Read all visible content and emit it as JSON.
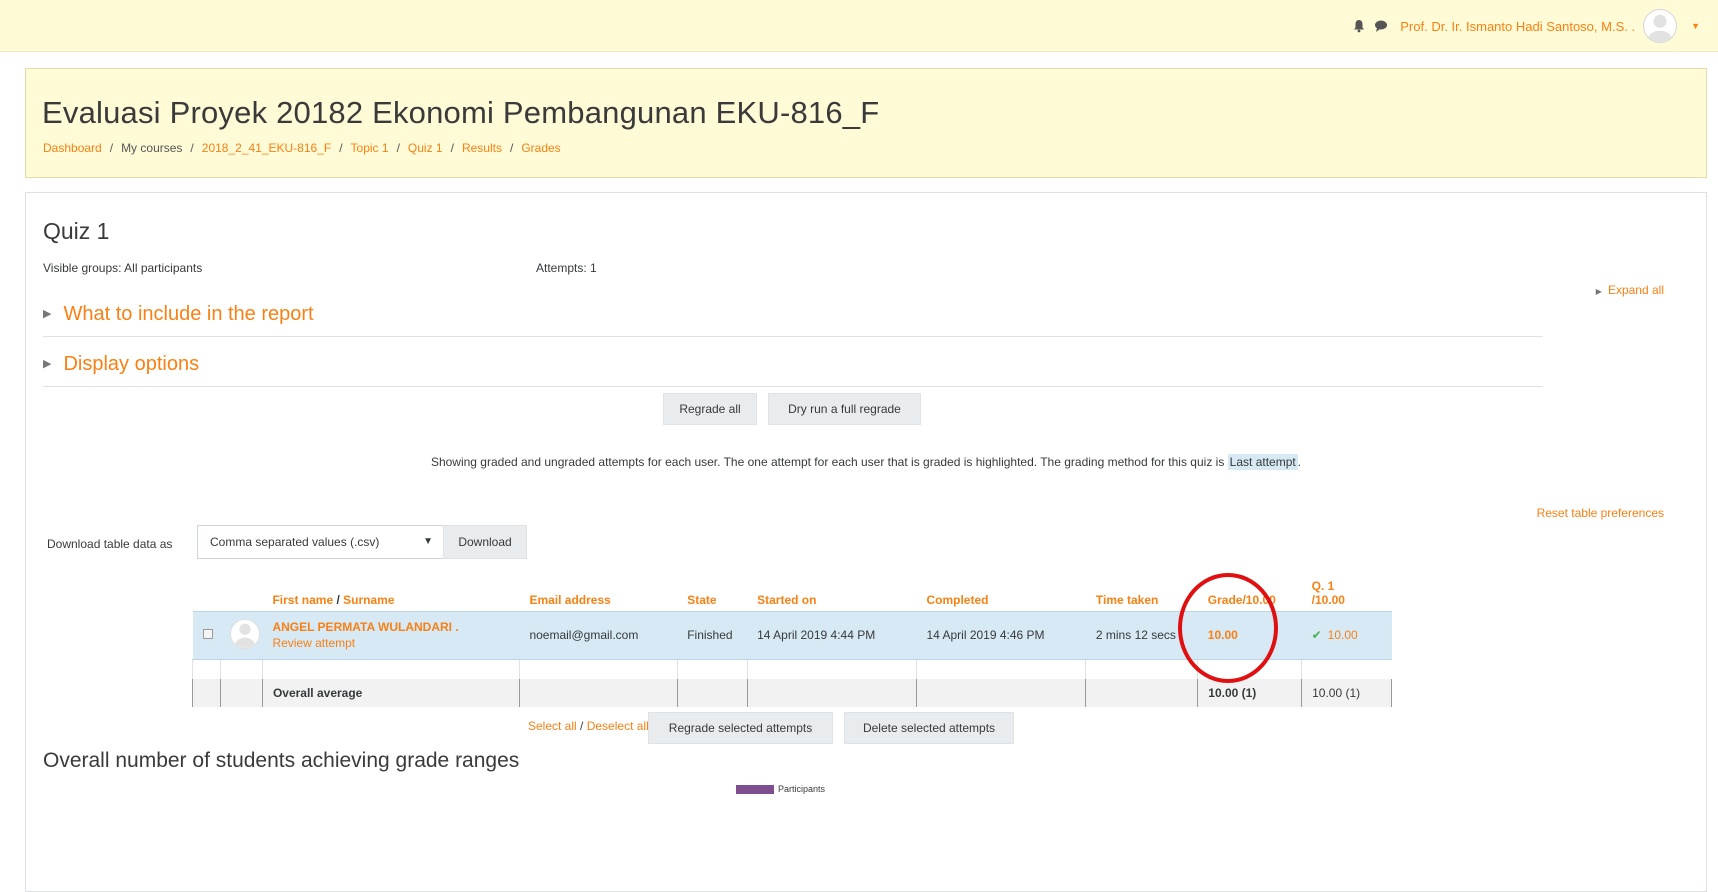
{
  "navbar": {
    "user_name": "Prof. Dr. Ir. Ismanto Hadi Santoso, M.S. .",
    "icons": [
      "bell-icon",
      "chat-icon"
    ]
  },
  "header": {
    "course_title": "Evaluasi Proyek 20182 Ekonomi Pembangunan EKU-816_F",
    "breadcrumb": [
      "Dashboard",
      "My courses",
      "2018_2_41_EKU-816_F",
      "Topic 1",
      "Quiz 1",
      "Results",
      "Grades"
    ]
  },
  "main": {
    "quiz_title": "Quiz 1",
    "groups_text": "Visible groups: All participants",
    "attempts_text": "Attempts: 1",
    "expand_all": "Expand all",
    "sections": {
      "include": "What to include in the report",
      "display": "Display options"
    },
    "buttons": {
      "regrade_all": "Regrade all",
      "dry_run": "Dry run a full regrade",
      "download": "Download",
      "regrade_selected": "Regrade selected attempts",
      "delete_selected": "Delete selected attempts"
    },
    "info_text": "Showing graded and ungraded attempts for each user. The one attempt for each user that is graded is highlighted. The grading method for this quiz is",
    "info_highlight": "Last attempt",
    "info_end": ".",
    "reset_prefs": "Reset table preferences",
    "download_label": "Download table data as",
    "download_format": "Comma separated values (.csv)",
    "select_all": "Select all",
    "select_sep": " / ",
    "deselect_all": "Deselect all",
    "ranges_title": "Overall number of students achieving grade ranges",
    "legend_label": "Participants"
  },
  "table": {
    "headers": {
      "first_name": "First name",
      "sep": " / ",
      "surname": "Surname",
      "email": "Email address",
      "state": "State",
      "started": "Started on",
      "completed": "Completed",
      "time_taken": "Time taken",
      "grade": "Grade/10.00",
      "q1_line1": "Q. 1",
      "q1_line2": "/10.00"
    },
    "row": {
      "name": "ANGEL PERMATA WULANDARI .",
      "review": "Review attempt",
      "email": "noemail@gmail.com",
      "state": "Finished",
      "started": "14 April 2019 4:44 PM",
      "completed": "14 April 2019 4:46 PM",
      "time_taken": "2 mins 12 secs",
      "grade": "10.00",
      "q1": "10.00"
    },
    "average": {
      "label": "Overall average",
      "grade": "10.00 (1)",
      "q1": "10.00 (1)"
    }
  },
  "colors": {
    "accent": "#f98012",
    "navbar_bg": "#fffbd6",
    "highlight_row": "#d6e9f5",
    "annotation_circle": "#e01010",
    "legend_swatch": "#7e4f8e"
  }
}
